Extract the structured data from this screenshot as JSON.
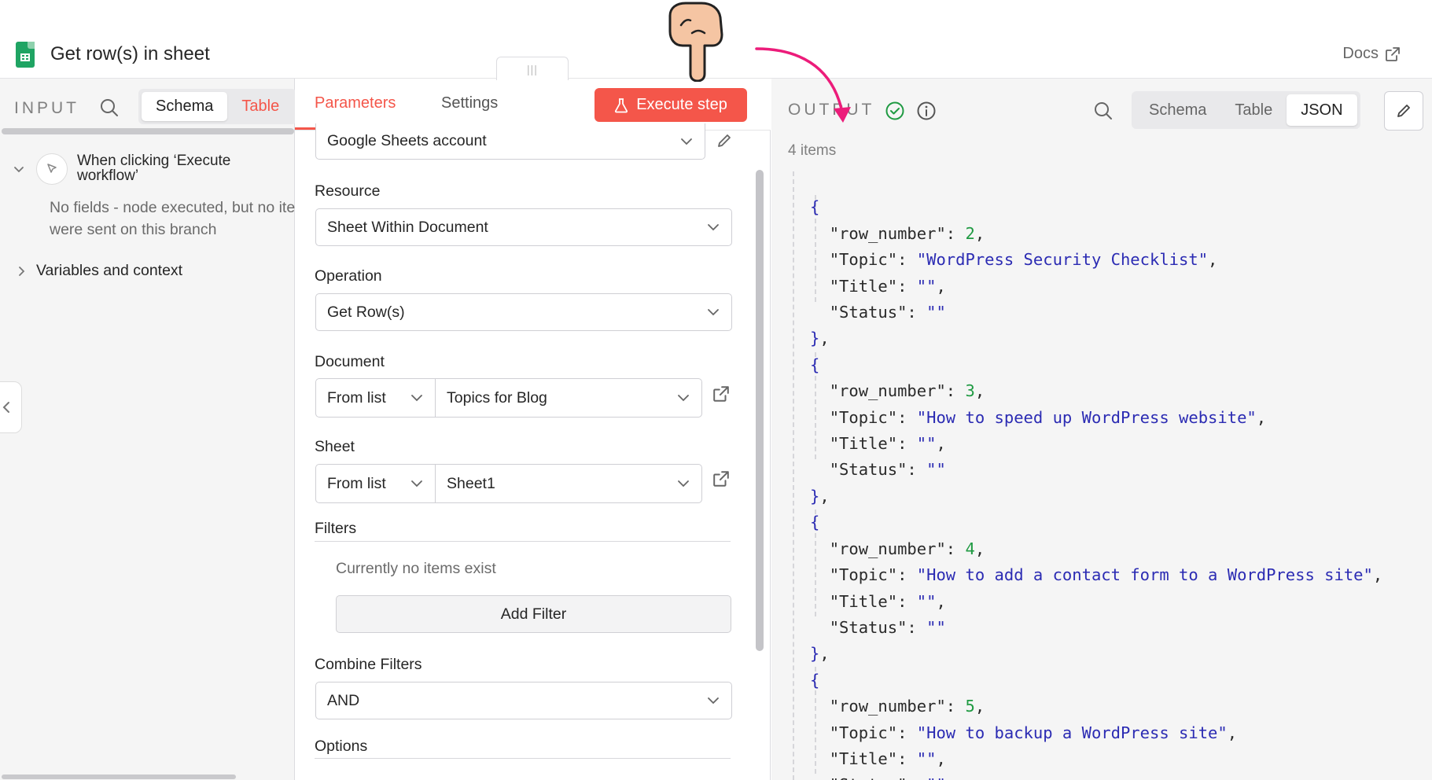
{
  "header": {
    "title": "Get row(s) in sheet",
    "docs_label": "Docs",
    "icon": "google-sheets-icon"
  },
  "input": {
    "label": "INPUT",
    "tabs": [
      "Schema",
      "Table"
    ],
    "active_tab": "Schema",
    "trigger": {
      "title_line1": "When clicking ‘Execute",
      "title_line2": "workflow’"
    },
    "no_fields_line1": "No fields - node executed, but no items",
    "no_fields_line2": "were sent on this branch",
    "variables_label": "Variables and context"
  },
  "params": {
    "tabs": {
      "parameters": "Parameters",
      "settings": "Settings"
    },
    "execute_label": "Execute step",
    "credential": "Google Sheets account",
    "resource": {
      "label": "Resource",
      "value": "Sheet Within Document"
    },
    "operation": {
      "label": "Operation",
      "value": "Get Row(s)"
    },
    "document": {
      "label": "Document",
      "mode": "From list",
      "value": "Topics for Blog"
    },
    "sheet": {
      "label": "Sheet",
      "mode": "From list",
      "value": "Sheet1"
    },
    "filters": {
      "label": "Filters",
      "empty_text": "Currently no items exist",
      "add_label": "Add Filter"
    },
    "combine_filters": {
      "label": "Combine Filters",
      "value": "AND"
    },
    "options_label": "Options"
  },
  "output": {
    "label": "OUTPUT",
    "tabs": [
      "Schema",
      "Table",
      "JSON"
    ],
    "active_tab": "JSON",
    "item_count": "4 items",
    "items": [
      {
        "row_number": "2",
        "Topic": "\"WordPress Security Checklist\"",
        "Title": "\"\"",
        "Status": "\"\""
      },
      {
        "row_number": "3",
        "Topic": "\"How to speed up WordPress website\"",
        "Title": "\"\"",
        "Status": "\"\""
      },
      {
        "row_number": "4",
        "Topic": "\"How to add a contact form to a WordPress site\"",
        "Title": "\"\"",
        "Status": "\"\""
      },
      {
        "row_number": "5",
        "Topic": "\"How to backup a WordPress site\"",
        "Title": "\"\"",
        "Status": "\"\""
      }
    ]
  },
  "colors": {
    "accent": "#f4564a",
    "annotation_arrow": "#ec1c7a",
    "json_number": "#1f9a42",
    "json_string": "#2b2bb3",
    "success": "#1f9a42"
  }
}
